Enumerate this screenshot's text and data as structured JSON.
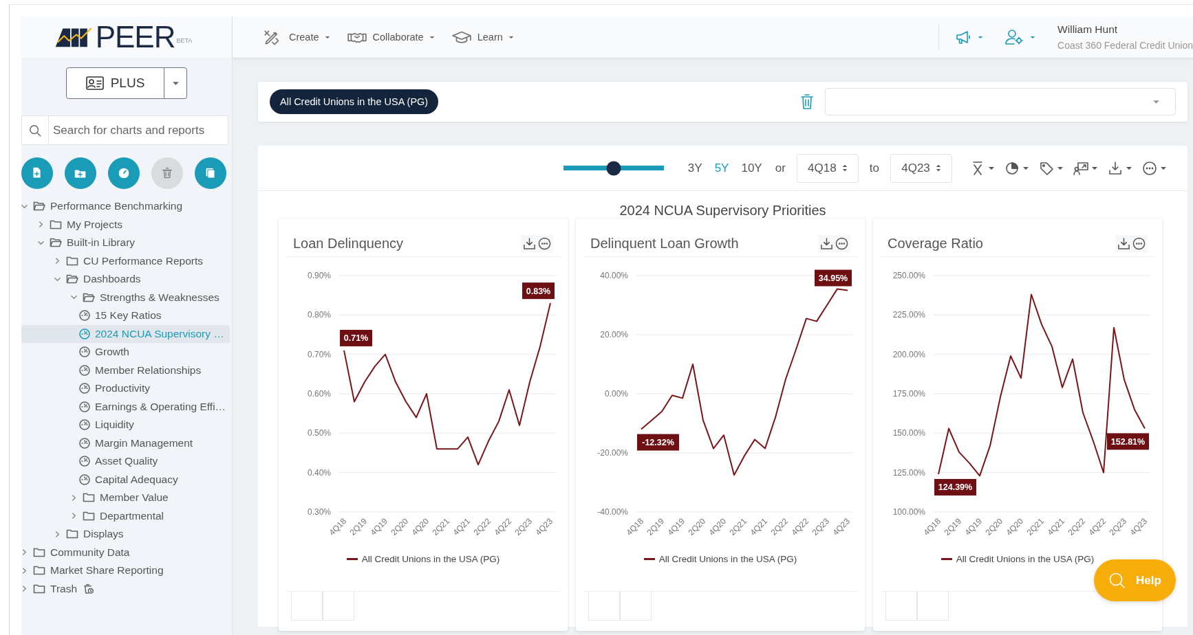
{
  "header": {
    "logo": {
      "name": "PEER",
      "badge": "BETA"
    },
    "nav": [
      {
        "label": "Create"
      },
      {
        "label": "Collaborate"
      },
      {
        "label": "Learn"
      }
    ],
    "user": {
      "name": "William Hunt",
      "organization": "Coast 360 Federal Credit Union"
    }
  },
  "sidebar": {
    "plan_button": {
      "label": "PLUS"
    },
    "search": {
      "placeholder": "Search for charts and reports"
    },
    "actions": [
      {
        "disabled": false
      },
      {
        "disabled": false
      },
      {
        "disabled": false
      },
      {
        "disabled": true
      },
      {
        "disabled": false
      }
    ],
    "tree": [
      {
        "label": "Performance Benchmarking",
        "kind": "folder",
        "expanded": true,
        "selected": false,
        "children": [
          {
            "label": "My Projects",
            "kind": "folder",
            "expanded": false,
            "selected": false
          },
          {
            "label": "Built-in Library",
            "kind": "folder",
            "expanded": true,
            "selected": false,
            "children": [
              {
                "label": "CU Performance Reports",
                "kind": "folder",
                "expanded": false,
                "selected": false
              },
              {
                "label": "Dashboards",
                "kind": "folder",
                "expanded": true,
                "selected": false,
                "children": [
                  {
                    "label": "Strengths & Weaknesses",
                    "kind": "folder",
                    "expanded": true,
                    "selected": false,
                    "children": [
                      {
                        "label": "15 Key Ratios",
                        "kind": "dashboard",
                        "selected": false
                      },
                      {
                        "label": "2024 NCUA Supervisory …",
                        "kind": "dashboard",
                        "selected": true
                      },
                      {
                        "label": "Growth",
                        "kind": "dashboard",
                        "selected": false
                      },
                      {
                        "label": "Member Relationships",
                        "kind": "dashboard",
                        "selected": false
                      },
                      {
                        "label": "Productivity",
                        "kind": "dashboard",
                        "selected": false
                      },
                      {
                        "label": "Earnings & Operating Effi…",
                        "kind": "dashboard",
                        "selected": false
                      },
                      {
                        "label": "Liquidity",
                        "kind": "dashboard",
                        "selected": false
                      },
                      {
                        "label": "Margin Management",
                        "kind": "dashboard",
                        "selected": false
                      },
                      {
                        "label": "Asset Quality",
                        "kind": "dashboard",
                        "selected": false
                      },
                      {
                        "label": "Capital Adequacy",
                        "kind": "dashboard",
                        "selected": false
                      }
                    ]
                  },
                  {
                    "label": "Member Value",
                    "kind": "folder",
                    "expanded": false,
                    "selected": false
                  },
                  {
                    "label": "Departmental",
                    "kind": "folder",
                    "expanded": false,
                    "selected": false
                  }
                ]
              },
              {
                "label": "Displays",
                "kind": "folder",
                "expanded": false,
                "selected": false
              }
            ]
          }
        ]
      },
      {
        "label": "Community Data",
        "kind": "folder",
        "expanded": false,
        "selected": false
      },
      {
        "label": "Market Share Reporting",
        "kind": "folder",
        "expanded": false,
        "selected": false
      },
      {
        "label": "Trash",
        "kind": "trash",
        "expanded": false,
        "selected": false
      }
    ]
  },
  "peer_group": {
    "chip": "All Credit Unions in the USA (PG)"
  },
  "toolbar": {
    "range": {
      "level": 0.5
    },
    "periods": [
      {
        "label": "3Y",
        "selected": false
      },
      {
        "label": "5Y",
        "selected": true
      },
      {
        "label": "10Y",
        "selected": false
      }
    ],
    "or_label": "or",
    "from": "4Q18",
    "to_label": "to",
    "to": "4Q23"
  },
  "dashboard": {
    "title": "2024 NCUA Supervisory Priorities",
    "charts": [
      {
        "title": "Loan Delinquency",
        "chart_data": {
          "type": "line",
          "categories": [
            "4Q18",
            null,
            "2Q19",
            null,
            "4Q19",
            null,
            "2Q20",
            null,
            "4Q20",
            null,
            "2Q21",
            null,
            "4Q21",
            null,
            "2Q22",
            null,
            "4Q22",
            null,
            "2Q23",
            null,
            "4Q23"
          ],
          "grid": true,
          "series": [
            {
              "name": "All Credit Unions in the USA (PG)",
              "color": "#7a1518",
              "values": [
                0.71,
                0.58,
                0.63,
                0.67,
                0.7,
                0.63,
                0.58,
                0.54,
                0.6,
                0.46,
                0.46,
                0.46,
                0.49,
                0.42,
                0.48,
                0.53,
                0.61,
                0.52,
                0.63,
                0.72,
                0.83
              ]
            }
          ],
          "ylim": [
            0.3,
            0.9
          ],
          "yticks": [
            {
              "value": 0.9,
              "label": "0.90%"
            },
            {
              "value": 0.8,
              "label": "0.80%"
            },
            {
              "value": 0.7,
              "label": "0.70%"
            },
            {
              "value": 0.6,
              "label": "0.60%"
            },
            {
              "value": 0.5,
              "label": "0.50%"
            },
            {
              "value": 0.4,
              "label": "0.40%"
            },
            {
              "value": 0.3,
              "label": "0.30%"
            }
          ],
          "annotations": [
            {
              "x": "4Q18",
              "y": 0.71,
              "text": "0.71%"
            },
            {
              "x": "4Q23",
              "y": 0.83,
              "text": "0.83%"
            }
          ]
        }
      },
      {
        "title": "Delinquent Loan Growth",
        "chart_data": {
          "type": "line",
          "categories": [
            "4Q18",
            null,
            "2Q19",
            null,
            "4Q19",
            null,
            "2Q20",
            null,
            "4Q20",
            null,
            "2Q21",
            null,
            "4Q21",
            null,
            "2Q22",
            null,
            "4Q22",
            null,
            "2Q23",
            null,
            "4Q23"
          ],
          "grid": true,
          "series": [
            {
              "name": "All Credit Unions in the USA (PG)",
              "color": "#7a1518",
              "values": [
                -12,
                -9,
                -6,
                -0.5,
                -1.5,
                10,
                -9,
                -18.5,
                -14,
                -27.5,
                -21,
                -15.5,
                -18.5,
                -8,
                5,
                15,
                25.5,
                24.5,
                30,
                35.5,
                35
              ]
            }
          ],
          "ylim": [
            -40,
            40
          ],
          "yticks": [
            {
              "value": 40,
              "label": "40.00%"
            },
            {
              "value": 20,
              "label": "20.00%"
            },
            {
              "value": 0,
              "label": "0.00%"
            },
            {
              "value": -20,
              "label": "-20.00%"
            },
            {
              "value": -40,
              "label": "-40.00%"
            }
          ],
          "annotations": [
            {
              "x": "4Q18",
              "y": -12,
              "text": "-12.32%"
            },
            {
              "x": "4Q23",
              "y": 35,
              "text": "34.95%"
            }
          ]
        }
      },
      {
        "title": "Coverage Ratio",
        "chart_data": {
          "type": "line",
          "categories": [
            "4Q18",
            null,
            "2Q19",
            null,
            "4Q19",
            null,
            "2Q20",
            null,
            "4Q20",
            null,
            "2Q21",
            null,
            "4Q21",
            null,
            "2Q22",
            null,
            "4Q22",
            null,
            "2Q23",
            null,
            "4Q23"
          ],
          "grid": true,
          "series": [
            {
              "name": "All Credit Unions in the USA (PG)",
              "color": "#7a1518",
              "values": [
                124,
                153,
                138,
                131,
                123,
                142,
                173,
                199,
                185,
                238,
                219,
                205,
                179,
                197,
                163,
                145,
                125,
                217,
                184,
                165,
                153
              ]
            }
          ],
          "ylim": [
            100,
            250
          ],
          "yticks": [
            {
              "value": 250,
              "label": "250.00%"
            },
            {
              "value": 225,
              "label": "225.00%"
            },
            {
              "value": 200,
              "label": "200.00%"
            },
            {
              "value": 175,
              "label": "175.00%"
            },
            {
              "value": 150,
              "label": "150.00%"
            },
            {
              "value": 125,
              "label": "125.00%"
            },
            {
              "value": 100,
              "label": "100.00%"
            }
          ],
          "annotations": [
            {
              "x": "4Q18",
              "y": 124,
              "text": "124.39%"
            },
            {
              "x": "4Q23",
              "y": 153,
              "text": "152.81%"
            }
          ]
        }
      }
    ]
  },
  "help": {
    "label": "Help"
  }
}
